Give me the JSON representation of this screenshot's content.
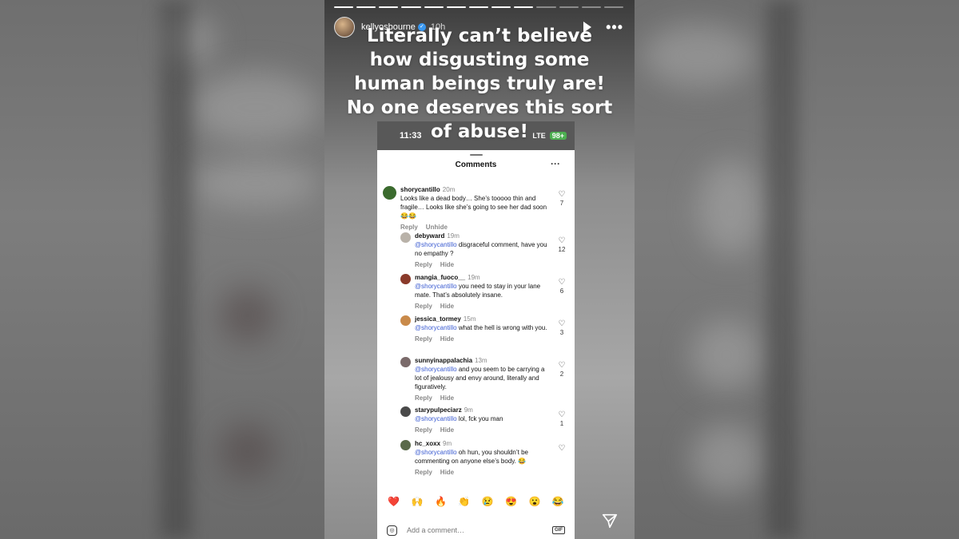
{
  "story": {
    "username": "kellyosbourne",
    "verified_icon": "✓",
    "time": "10h",
    "caption_lines": [
      "Literally can’t believe",
      "how disgusting some",
      "human beings truly are!",
      "No one deserves this sort",
      "of abuse!"
    ],
    "progress_segments": 13,
    "progress_done": 9
  },
  "phone": {
    "clock": "11:33",
    "network": "LTE",
    "battery": "98+"
  },
  "sheet": {
    "title": "Comments",
    "more": "···"
  },
  "comments": [
    {
      "user": "shorycantillo",
      "time": "20m",
      "mention": "",
      "text": "Looks like a dead body… She’s tooooo thin and fragile… Looks like she’s going to see her dad soon 😂😂",
      "likes": "7",
      "actions": [
        "Reply",
        "Unhide"
      ],
      "reply": false,
      "avatar_color": "#3b6b2e"
    },
    {
      "user": "debyward",
      "time": "19m",
      "mention": "@shorycantillo",
      "text": " disgraceful comment, have you no empathy ?",
      "likes": "12",
      "actions": [
        "Reply",
        "Hide"
      ],
      "reply": true,
      "avatar_color": "#b9b2a9"
    },
    {
      "user": "mangia_fuoco__",
      "time": "19m",
      "mention": "@shorycantillo",
      "text": " you need to stay in your lane mate. That’s absolutely insane.",
      "likes": "6",
      "actions": [
        "Reply",
        "Hide"
      ],
      "reply": true,
      "avatar_color": "#8a3a2a"
    },
    {
      "user": "jessica_tormey",
      "time": "15m",
      "mention": "@shorycantillo",
      "text": " what the hell is wrong with you.",
      "likes": "3",
      "actions": [
        "Reply",
        "Hide"
      ],
      "reply": true,
      "avatar_color": "#c98a4a"
    },
    {
      "user": "sunnyinappalachia",
      "time": "13m",
      "mention": "@shorycantillo",
      "text": " and you seem to be carrying a lot of jealousy and envy around, literally and figuratively.",
      "likes": "2",
      "actions": [
        "Reply",
        "Hide"
      ],
      "reply": true,
      "avatar_color": "#7a6a6a"
    },
    {
      "user": "starypulpeciarz",
      "time": "9m",
      "mention": "@shorycantillo",
      "text": " lol, fck you man",
      "likes": "1",
      "actions": [
        "Reply",
        "Hide"
      ],
      "reply": true,
      "avatar_color": "#4a4a4a"
    },
    {
      "user": "hc_xoxx",
      "time": "9m",
      "mention": "@shorycantillo",
      "text": " oh hun, you shouldn’t be commenting on anyone else’s body. 😂",
      "likes": "",
      "actions": [
        "Reply",
        "Hide"
      ],
      "reply": true,
      "avatar_color": "#5a6a4a"
    }
  ],
  "reactions": [
    "❤️",
    "🙌",
    "🔥",
    "👏",
    "😢",
    "😍",
    "😮",
    "😂"
  ],
  "add_comment": {
    "placeholder": "Add a comment…",
    "gif_label": "GIF",
    "camera_icon": "camera-icon"
  },
  "icons": {
    "play": "play-icon",
    "more": "more-icon",
    "send": "send-icon",
    "heart": "♡"
  }
}
